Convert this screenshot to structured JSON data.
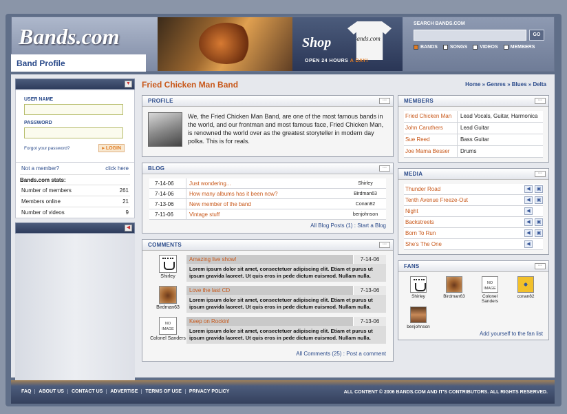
{
  "header": {
    "logo": "Bands.com",
    "shop_word": "Shop",
    "tshirt_text": "Bands.com",
    "shop_tag": "OPEN 24 HOURS",
    "shop_tag_accent": "A DAY!",
    "search_label": "SEARCH BANDS.COM",
    "search_value": "",
    "go": "GO",
    "filters": [
      {
        "label": "BANDS",
        "checked": true
      },
      {
        "label": "SONGS",
        "checked": false
      },
      {
        "label": "VIDEOS",
        "checked": false
      },
      {
        "label": "MEMBERS",
        "checked": false
      }
    ],
    "section_title": "Band Profile"
  },
  "sidebar": {
    "username_label": "USER NAME",
    "password_label": "PASSWORD",
    "forgot": "Forgot your password?",
    "login": "LOGIN",
    "not_member": "Not a member?",
    "click_here": "click here",
    "stats_title": "Bands.com stats:",
    "stats": [
      {
        "label": "Number of members",
        "value": "261"
      },
      {
        "label": "Members online",
        "value": "21"
      },
      {
        "label": "Number of videos",
        "value": "9"
      }
    ]
  },
  "page": {
    "band_name": "Fried Chicken Man Band",
    "breadcrumb": "Home » Genres » Blues » Delta"
  },
  "profile": {
    "heading": "PROFILE",
    "text": "We, the Fried Chicken Man Band, are one of the most famous bands in the world, and our frontman and most famous face, Fried Chicken Man, is renowned the world over as the greatest storyteller in modern day polka. This is for reals."
  },
  "blog": {
    "heading": "BLOG",
    "posts": [
      {
        "date": "7-14-06",
        "title": "Just wondering...",
        "user": "Shirley"
      },
      {
        "date": "7-14-06",
        "title": "How many albums has it been now?",
        "user": "Birdman63"
      },
      {
        "date": "7-13-06",
        "title": "New member of the band",
        "user": "Conan82"
      },
      {
        "date": "7-11-06",
        "title": "Vintage stuff",
        "user": "benjohnson"
      }
    ],
    "footer": "All Blog Posts (1) : Start a Blog"
  },
  "comments": {
    "heading": "COMMENTS",
    "items": [
      {
        "user": "Shirley",
        "title": "Amazing live show!",
        "date": "7-14-06",
        "text": "Lorem ipsum dolor sit amet, consectetuer adipiscing elit. Etiam et purus ut ipsum gravida laoreet. Ut quis eros in pede dictum euismod. Nullam nulla."
      },
      {
        "user": "Birdman63",
        "title": "Love the last CD",
        "date": "7-13-06",
        "text": "Lorem ipsum dolor sit amet, consectetuer adipiscing elit. Etiam et purus ut ipsum gravida laoreet. Ut quis eros in pede dictum euismod. Nullam nulla."
      },
      {
        "user": "Colonel Sanders",
        "title": "Keep on Rockin!",
        "date": "7-13-06",
        "text": "Lorem ipsum dolor sit amet, consectetuer adipiscing elit. Etiam et purus ut ipsum gravida laoreet. Ut quis eros in pede dictum euismod. Nullam nulla."
      }
    ],
    "no_image": "NO IMAGE",
    "footer": "All Comments (25) : Post a comment"
  },
  "members": {
    "heading": "MEMBERS",
    "items": [
      {
        "name": "Fried Chicken Man",
        "role": "Lead Vocals, Guitar, Harmonica"
      },
      {
        "name": "John Caruthers",
        "role": "Lead Guitar"
      },
      {
        "name": "Sue Reed",
        "role": "Bass Guitar"
      },
      {
        "name": "Joe Mama Besser",
        "role": "Drums"
      }
    ]
  },
  "media": {
    "heading": "MEDIA",
    "items": [
      {
        "title": "Thunder Road",
        "video": true
      },
      {
        "title": "Tenth Avenue Freeze-Out",
        "video": true
      },
      {
        "title": "Night",
        "video": false
      },
      {
        "title": "Backstreets",
        "video": true
      },
      {
        "title": "Born To Run",
        "video": true
      },
      {
        "title": "She's The One",
        "video": false
      }
    ]
  },
  "fans": {
    "heading": "FANS",
    "items": [
      {
        "name": "Shirley"
      },
      {
        "name": "Birdman63"
      },
      {
        "name": "Colonel Sanders"
      },
      {
        "name": "conan82"
      },
      {
        "name": "benjohnson"
      }
    ],
    "footer": "Add yourself to the fan list"
  },
  "footer": {
    "links": [
      "FAQ",
      "ABOUT US",
      "CONTACT US",
      "ADVERTISE",
      "TERMS OF USE",
      "PRIVACY POLICY"
    ],
    "copyright": "ALL CONTENT © 2006 BANDS.COM AND IT'S CONTRIBUTORS. ALL RIGHTS RESERVED."
  }
}
